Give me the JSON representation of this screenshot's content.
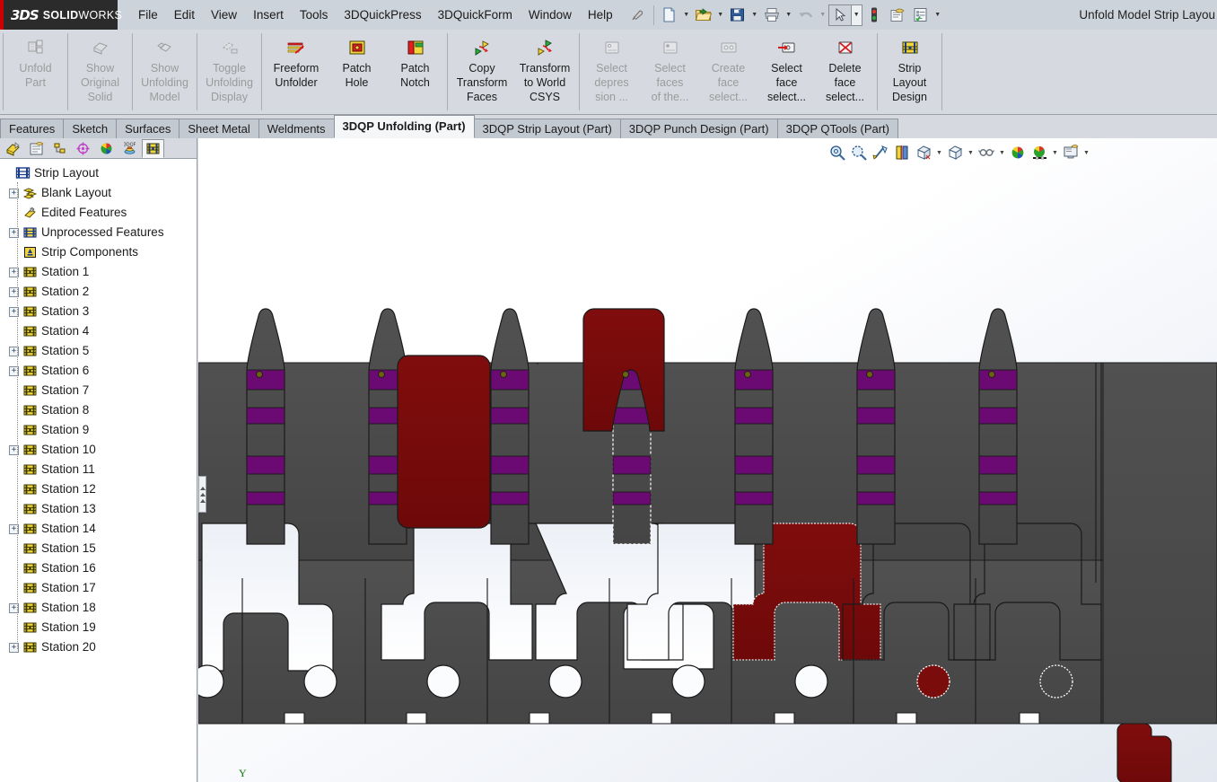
{
  "app": {
    "brand_ds": "3DS",
    "brand_bold": "SOLID",
    "brand_light": "WORKS",
    "document_title": "Unfold Model Strip Layou"
  },
  "menubar": {
    "items": [
      {
        "label": "File"
      },
      {
        "label": "Edit"
      },
      {
        "label": "View"
      },
      {
        "label": "Insert"
      },
      {
        "label": "Tools"
      },
      {
        "label": "3DQuickPress"
      },
      {
        "label": "3DQuickForm"
      },
      {
        "label": "Window"
      },
      {
        "label": "Help"
      }
    ],
    "icons": [
      {
        "name": "pin-icon"
      },
      {
        "name": "new-document-icon"
      },
      {
        "name": "open-folder-icon"
      },
      {
        "name": "save-icon"
      },
      {
        "name": "print-icon"
      },
      {
        "name": "undo-icon"
      },
      {
        "name": "select-arrow-icon"
      },
      {
        "name": "rebuild-traffic-icon"
      },
      {
        "name": "options-icon"
      },
      {
        "name": "checklist-icon"
      }
    ]
  },
  "ribbon": {
    "groups": [
      {
        "buttons": [
          {
            "label": "Unfold\nPart",
            "icon": "unfold-part-icon",
            "disabled": true
          },
          {
            "label": "Show\nOriginal\nSolid",
            "icon": "show-original-solid-icon",
            "disabled": true
          },
          {
            "label": "Show\nUnfolding\nModel",
            "icon": "show-unfolding-model-icon",
            "disabled": true
          },
          {
            "label": "Toggle\nUnfolding\nDisplay",
            "icon": "toggle-unfolding-display-icon",
            "disabled": true
          }
        ]
      },
      {
        "buttons": [
          {
            "label": "Freeform\nUnfolder",
            "icon": "freeform-unfolder-icon",
            "disabled": false
          },
          {
            "label": "Patch\nHole",
            "icon": "patch-hole-icon",
            "disabled": false
          },
          {
            "label": "Patch\nNotch",
            "icon": "patch-notch-icon",
            "disabled": false
          }
        ]
      },
      {
        "buttons": [
          {
            "label": "Copy\nTransform\nFaces",
            "icon": "copy-transform-faces-icon",
            "disabled": false
          },
          {
            "label": "Transform\nto World\nCSYS",
            "icon": "transform-to-world-csys-icon",
            "disabled": false
          }
        ]
      },
      {
        "buttons": [
          {
            "label": "Select\ndepres\nsion ...",
            "icon": "select-depression-icon",
            "disabled": true
          },
          {
            "label": "Select\nfaces\nof the...",
            "icon": "select-faces-icon",
            "disabled": true
          },
          {
            "label": "Create\nface\nselect...",
            "icon": "create-face-selection-icon",
            "disabled": true
          },
          {
            "label": "Select\nface\nselect...",
            "icon": "select-face-selection-icon",
            "disabled": false
          },
          {
            "label": "Delete\nface\nselect...",
            "icon": "delete-face-selection-icon",
            "disabled": false
          }
        ]
      },
      {
        "buttons": [
          {
            "label": "Strip\nLayout\nDesign",
            "icon": "strip-layout-design-icon",
            "disabled": false
          }
        ]
      }
    ]
  },
  "tabs": [
    {
      "label": "Features",
      "active": false
    },
    {
      "label": "Sketch",
      "active": false
    },
    {
      "label": "Surfaces",
      "active": false
    },
    {
      "label": "Sheet Metal",
      "active": false
    },
    {
      "label": "Weldments",
      "active": false
    },
    {
      "label": "3DQP Unfolding (Part)",
      "active": true
    },
    {
      "label": "3DQP Strip Layout (Part)",
      "active": false
    },
    {
      "label": "3DQP Punch Design (Part)",
      "active": false
    },
    {
      "label": "3DQP QTools (Part)",
      "active": false
    }
  ],
  "tree_toolbar": {
    "buttons": [
      {
        "name": "feature-manager-tab-icon",
        "selected": false
      },
      {
        "name": "property-manager-tab-icon",
        "selected": false
      },
      {
        "name": "configuration-manager-tab-icon",
        "selected": false
      },
      {
        "name": "dimxpert-manager-tab-icon",
        "selected": false
      },
      {
        "name": "display-manager-tab-icon",
        "selected": false
      },
      {
        "name": "3dqf-manager-tab-icon",
        "selected": false
      },
      {
        "name": "strip-layout-manager-tab-icon",
        "selected": true
      }
    ]
  },
  "tree": {
    "root": {
      "label": "Strip Layout",
      "icon": "strip-layout-icon"
    },
    "items": [
      {
        "label": "Blank Layout",
        "icon": "blank-layout-icon",
        "expandable": true
      },
      {
        "label": "Edited Features",
        "icon": "edited-features-icon",
        "expandable": false
      },
      {
        "label": "Unprocessed Features",
        "icon": "unprocessed-features-icon",
        "expandable": true
      },
      {
        "label": "Strip Components",
        "icon": "strip-components-icon",
        "expandable": false
      },
      {
        "label": "Station 1",
        "icon": "station-icon",
        "expandable": true
      },
      {
        "label": "Station 2",
        "icon": "station-icon",
        "expandable": true
      },
      {
        "label": "Station 3",
        "icon": "station-icon",
        "expandable": true
      },
      {
        "label": "Station 4",
        "icon": "station-icon",
        "expandable": false
      },
      {
        "label": "Station 5",
        "icon": "station-icon",
        "expandable": true
      },
      {
        "label": "Station 6",
        "icon": "station-icon",
        "expandable": true
      },
      {
        "label": "Station 7",
        "icon": "station-icon",
        "expandable": false
      },
      {
        "label": "Station 8",
        "icon": "station-icon",
        "expandable": false
      },
      {
        "label": "Station 9",
        "icon": "station-icon",
        "expandable": false
      },
      {
        "label": "Station 10",
        "icon": "station-icon",
        "expandable": true
      },
      {
        "label": "Station 11",
        "icon": "station-icon",
        "expandable": false
      },
      {
        "label": "Station 12",
        "icon": "station-icon",
        "expandable": false
      },
      {
        "label": "Station 13",
        "icon": "station-icon",
        "expandable": false
      },
      {
        "label": "Station 14",
        "icon": "station-icon",
        "expandable": true
      },
      {
        "label": "Station 15",
        "icon": "station-icon",
        "expandable": false
      },
      {
        "label": "Station 16",
        "icon": "station-icon",
        "expandable": false
      },
      {
        "label": "Station 17",
        "icon": "station-icon",
        "expandable": false
      },
      {
        "label": "Station 18",
        "icon": "station-icon",
        "expandable": true
      },
      {
        "label": "Station 19",
        "icon": "station-icon",
        "expandable": false
      },
      {
        "label": "Station 20",
        "icon": "station-icon",
        "expandable": true
      }
    ]
  },
  "view_toolbar": {
    "buttons": [
      {
        "name": "zoom-to-fit-icon",
        "dropdown": false
      },
      {
        "name": "zoom-to-area-icon",
        "dropdown": false
      },
      {
        "name": "previous-view-icon",
        "dropdown": false
      },
      {
        "name": "section-view-icon",
        "dropdown": false
      },
      {
        "name": "view-orientation-icon",
        "dropdown": true
      },
      {
        "name": "display-style-icon",
        "dropdown": true
      },
      {
        "name": "hide-show-items-icon",
        "dropdown": true
      },
      {
        "name": "appearances-icon",
        "dropdown": false
      },
      {
        "name": "apply-scene-icon",
        "dropdown": true
      },
      {
        "name": "view-settings-icon",
        "dropdown": true
      }
    ]
  },
  "graphics": {
    "axis_label_y": "Y",
    "colors": {
      "body_gray": "#4b4b4b",
      "highlight_red": "#7a0c0c",
      "band_purple": "#6b0a72",
      "white_face": "#f2f4f8",
      "pin_gold": "#6e6410",
      "outline": "#1a1a1a"
    },
    "part_description": "Progressive die strip layout flat pattern with carrier strip, pilot holes, formed prongs and highlighted red features"
  }
}
